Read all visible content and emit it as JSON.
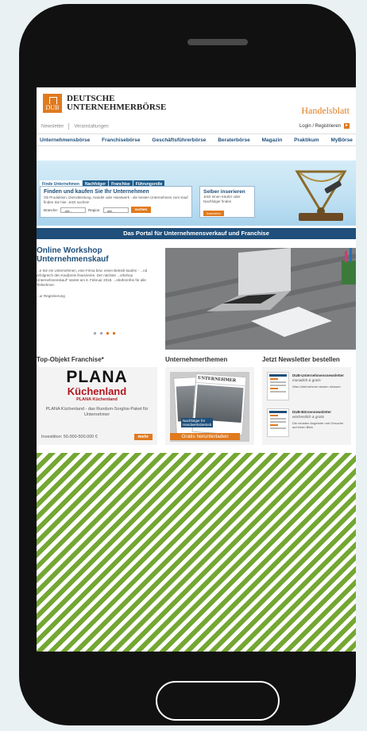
{
  "brand": {
    "logo_line1": "DEUTSCHE",
    "logo_line2": "UNTERNEHMERBÖRSE",
    "logo_mark": "DUB",
    "partner": "Handelsblatt"
  },
  "top_links": [
    "Newsletter",
    "Veranstaltungen"
  ],
  "login": {
    "label": "Login / Registrieren",
    "icon": "user-icon"
  },
  "nav": [
    "Unternehmensbörse",
    "Franchisebörse",
    "Geschäftsführerbörse",
    "Beraterbörse",
    "Magazin",
    "Praktikum",
    "MyBörse"
  ],
  "hero": {
    "tabs": [
      "Finde Unternehmen",
      "Nachfolger",
      "Franchise",
      "Führungsrolle"
    ],
    "find_title": "Finden und kaufen Sie Ihr Unternehmen",
    "find_desc": "Ob Produktion, Dienstleistung, Handel oder Handwerk - die besten Unternehmen zum Kauf finden Sie hier. Jetzt suchen!",
    "branche_label": "Branche:",
    "branche_value": "- alle -",
    "region_label": "Region:",
    "region_value": "- alle -",
    "search_button": "suchen",
    "insert_title": "Selber inserieren",
    "insert_desc": "Jetzt einen Käufer oder Nachfolger finden",
    "insert_button": "Inserieren"
  },
  "banner": "Das Portal für Unternehmensverkauf und Franchise",
  "workshop": {
    "title_line1": "Online Workshop",
    "title_line2": "Unternehmenskauf",
    "text": "...e Sie ein Unternehmen, eine Firma bzw. einen Betrieb kaufen - ...nd erfolgreich den Kaufpreis finanzieren. Der nächste ...orkshop Unternehmenskauf\" startet am 6. Februar 2018. ...ebührenfrei für alle Teilnehmer.",
    "reg": "...ur Registrierung"
  },
  "sections": {
    "franchise_title": "Top-Objekt Franchise*",
    "themes_title": "Unternehmerthemen",
    "newsletter_title": "Jetzt Newsletter bestellen"
  },
  "franchise": {
    "logo_word": "PLANA",
    "logo_sub": "Küchenland",
    "company": "PLANA Küchenland",
    "desc": "PLANA Küchenland - das Rundum-Sorglos-Paket für Unternehmer",
    "investment": "Investition: 50.000-500.000 €",
    "more_button": "mehr"
  },
  "magazine": {
    "cover_title": "UNTERNEHMER",
    "cover_label_1": "Nachfolger für",
    "cover_label_2": "Handwerksbetrieb",
    "cta": "Gratis herunterladen"
  },
  "newsletters": [
    {
      "title": "DUB-Unternehmensnewsletter",
      "freq": "monatlich & gratis",
      "desc": "Was Unternehmer wissen müssen"
    },
    {
      "title": "DUB-Börsennewsletter",
      "freq": "wöchentlich & gratis",
      "desc": "Die neusten Angebote und Gesuche auf einen Blick"
    }
  ],
  "colors": {
    "accent": "#e07a1f",
    "navy": "#1f4f7a",
    "stripe": "#74a733"
  }
}
